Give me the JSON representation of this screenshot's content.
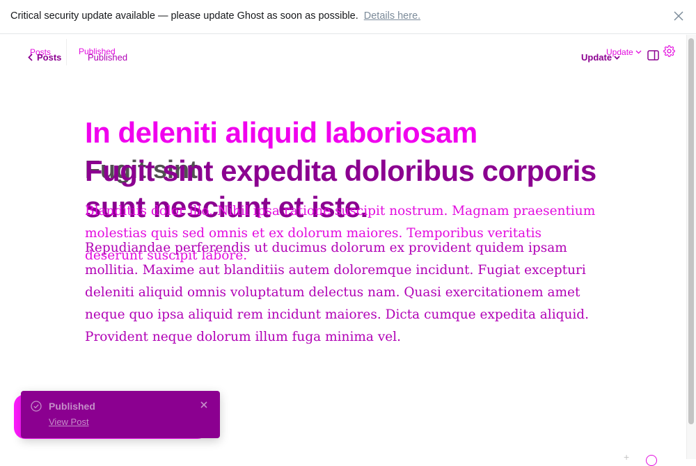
{
  "banner": {
    "message": "Critical security update available — please update Ghost as soon as possible.",
    "link_label": "Details here."
  },
  "header": {
    "back_label_ghost": "Posts",
    "back_label": "Posts",
    "status_ghost": "Published",
    "status": "Published",
    "update_label_ghost": "Update",
    "update_label": "Update"
  },
  "post": {
    "ghost_title": "In deleniti aliquid laboriosam",
    "ghost_subtitle": "Fugit sint",
    "title": "Fugit sint expedita doloribus corporis sunt nesciunt et iste.",
    "ghost_body": "Blanditiis dolor illo. Nihil ipsa ratione suscipit nostrum. Magnam praesentium molestias quis sed omnis et ex dolorum maiores. Temporibus veritatis deserunt suscipit labore.",
    "body": "Repudiandae perferendis ut ducimus dolorum ex provident quidem ipsam mollitia. Maxime aut blanditiis autem doloremque incidunt. Fugiat excepturi deleniti aliquid omnis voluptatum delectus nam. Quasi exercitationem amet neque quo ipsa aliquid rem incidunt maiores. Dicta cumque expedita aliquid. Provident neque dolorum illum fuga minima vel."
  },
  "toast": {
    "title": "Published",
    "link_label": "View Post"
  },
  "colors": {
    "accent_dark": "#8b0090",
    "accent_mid": "#b000b5",
    "accent_bright": "#e20bde",
    "ghost_pink": "#f000ee"
  },
  "icons": [
    "close-icon",
    "chevron-left-icon",
    "chevron-down-icon",
    "sidebar-toggle-icon",
    "gear-icon",
    "check-circle-icon",
    "help-icon"
  ]
}
